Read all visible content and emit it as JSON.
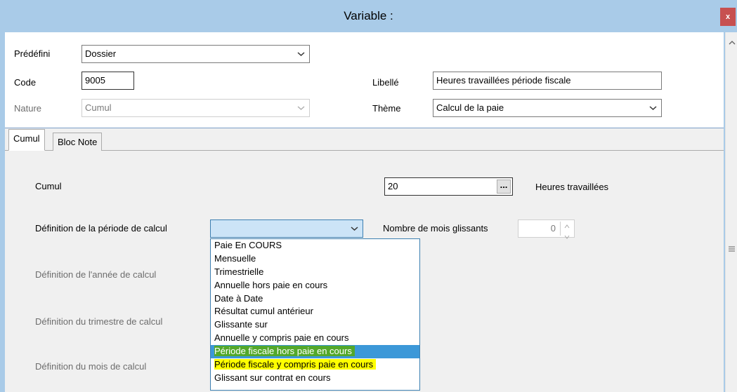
{
  "window": {
    "title": "Variable :",
    "close_label": "x"
  },
  "header": {
    "predefini_label": "Prédéfini",
    "predefini_value": "Dossier",
    "code_label": "Code",
    "code_value": "9005",
    "nature_label": "Nature",
    "nature_value": "Cumul",
    "libelle_label": "Libellé",
    "libelle_value": "Heures travaillées période fiscale",
    "theme_label": "Thème",
    "theme_value": "Calcul de la paie"
  },
  "tabs": [
    {
      "label": "Cumul",
      "active": true
    },
    {
      "label": "Bloc Note",
      "active": false
    }
  ],
  "cumul_tab": {
    "cumul_label": "Cumul",
    "cumul_value": "20",
    "browse_label": "...",
    "cumul_description": "Heures travaillées",
    "periode_label": "Définition de la période de calcul",
    "periode_value": "",
    "mois_glissants_label": "Nombre de mois glissants",
    "mois_glissants_value": "0",
    "annee_label": "Définition de l'année de calcul",
    "trimestre_label": "Définition du trimestre de calcul",
    "mois_label": "Définition du mois de calcul"
  },
  "dropdown": {
    "options": [
      "Paie En COURS",
      "Mensuelle",
      "Trimestrielle",
      "Annuelle hors paie en cours",
      "Date à Date",
      "Résultat cumul antérieur",
      "Glissante sur",
      "Annuelle y compris paie en cours",
      "Période fiscale hors paie en cours",
      "Période fiscale y compris paie en cours",
      "Glissant sur contrat en cours"
    ],
    "selected_index": 8,
    "highlighted_index": 9
  },
  "colors": {
    "title_bar": "#a9cbe8",
    "selection": "#3c98d8",
    "selection_marker": "#53a82b",
    "highlight": "#ffff00",
    "close_button": "#c75050"
  },
  "icons": [
    "close-icon",
    "chevron-down-icon",
    "scroll-up-icon",
    "scroll-grip-icon",
    "spin-up-icon",
    "spin-down-icon"
  ]
}
